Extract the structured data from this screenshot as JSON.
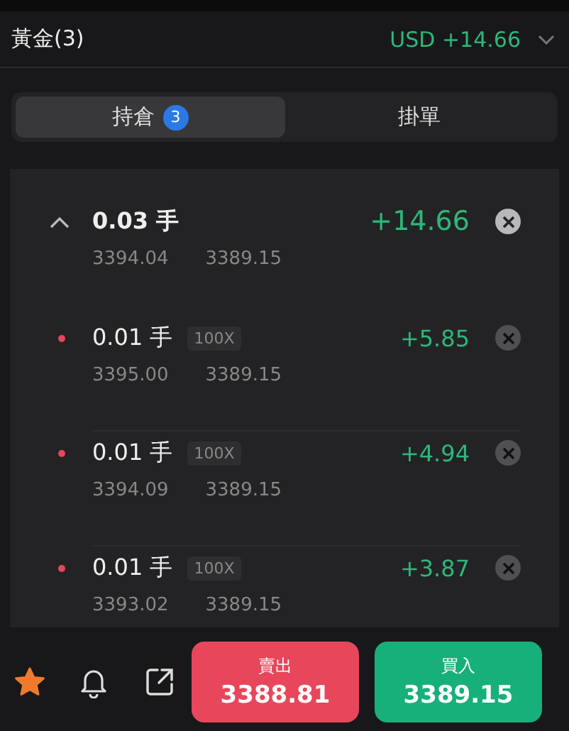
{
  "header": {
    "title": "黃金(3)",
    "pnl": "USD +14.66"
  },
  "tabs": [
    {
      "label": "持倉",
      "badge": "3",
      "selected": true
    },
    {
      "label": "掛單",
      "selected": false
    }
  ],
  "group": {
    "lots": "0.03 手",
    "expanded": true,
    "open_price": "3394.04",
    "current_price": "3389.15",
    "pnl": "+14.66",
    "children": [
      {
        "lots": "0.01 手",
        "color": "#e8465b",
        "leverage": "100X",
        "open_price": "3395.00",
        "current_price": "3389.15",
        "pnl": "+5.85"
      },
      {
        "lots": "0.01 手",
        "color": "#e8465b",
        "leverage": "100X",
        "open_price": "3394.09",
        "current_price": "3389.15",
        "pnl": "+4.94"
      },
      {
        "lots": "0.01 手",
        "color": "#e8465b",
        "leverage": "100X",
        "open_price": "3393.02",
        "current_price": "3389.15",
        "pnl": "+3.87"
      }
    ]
  },
  "footer": {
    "favorited": true,
    "sell": {
      "label": "賣出",
      "price": "3388.81"
    },
    "buy": {
      "label": "買入",
      "price": "3389.15"
    }
  }
}
